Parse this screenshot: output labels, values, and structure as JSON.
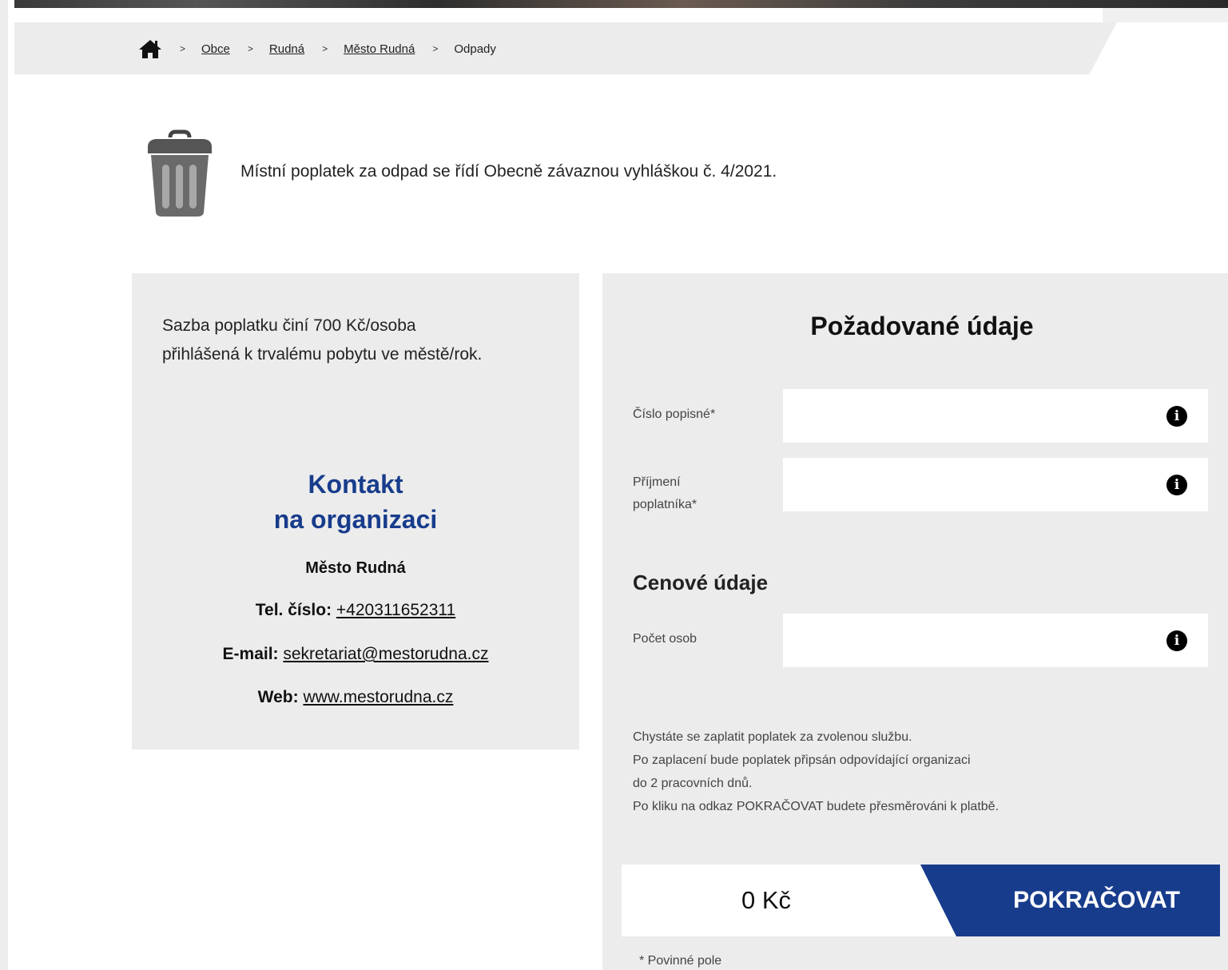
{
  "breadcrumb": {
    "items": [
      "Obce",
      "Rudná",
      "Město Rudná"
    ],
    "current": "Odpady",
    "separator": ">"
  },
  "notice": {
    "text": "Místní poplatek za odpad se řídí Obecně závaznou vyhláškou č. 4/2021."
  },
  "info": {
    "rate_text": "Sazba poplatku činí 700 Kč/osoba přihlášená k trvalému pobytu ve městě/rok.",
    "contact_title_line1": "Kontakt",
    "contact_title_line2": "na organizaci",
    "org_name": "Město Rudná",
    "phone_label": "Tel. číslo:",
    "phone_value": "+420311652311",
    "email_label": "E-mail:",
    "email_value": "sekretariat@mestorudna.cz",
    "web_label": "Web:",
    "web_value": "www.mestorudna.cz"
  },
  "form": {
    "title": "Požadované údaje",
    "fields": [
      {
        "label": "Číslo popisné*",
        "value": ""
      },
      {
        "label": "Příjmení poplatníka*",
        "value": ""
      }
    ],
    "price_section_title": "Cenové údaje",
    "price_fields": [
      {
        "label": "Počet osob",
        "value": ""
      }
    ],
    "info_icon_glyph": "i",
    "payment_note": [
      "Chystáte se zaplatit poplatek za zvolenou službu.",
      "Po zaplacení bude poplatek připsán odpovídající organizaci",
      "do 2 pracovních dnů.",
      "Po kliku na odkaz POKRAČOVAT budete přesměrováni k platbě."
    ],
    "amount": "0 Kč",
    "continue_label": "POKRAČOVAT",
    "required_note": "* Povinné pole"
  },
  "colors": {
    "accent": "#183c8c",
    "panel_bg": "#ececec"
  }
}
